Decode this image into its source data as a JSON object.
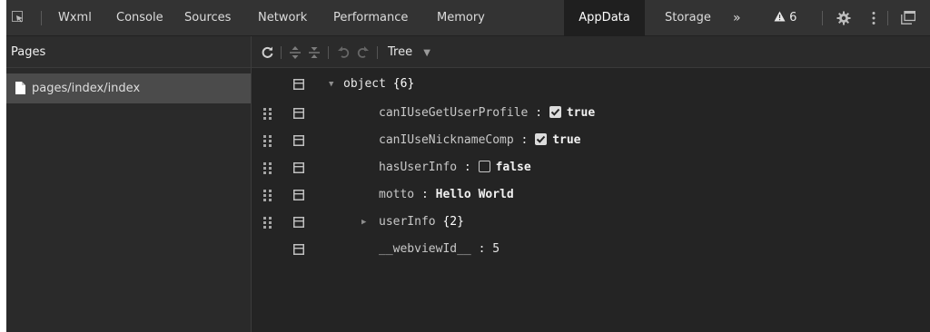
{
  "tabs": [
    {
      "label": "Wxml",
      "active": false
    },
    {
      "label": "Console",
      "active": false
    },
    {
      "label": "Sources",
      "active": false
    },
    {
      "label": "Network",
      "active": false
    },
    {
      "label": "Performance",
      "active": false
    },
    {
      "label": "Memory",
      "active": false
    },
    {
      "label": "AppData",
      "active": true
    },
    {
      "label": "Storage",
      "active": false
    }
  ],
  "more_tabs_label": "»",
  "warning_count": "6",
  "left_panel": {
    "header": "Pages",
    "items": [
      {
        "label": "pages/index/index",
        "selected": true
      }
    ]
  },
  "toolbar": {
    "view_mode": "Tree"
  },
  "tree": {
    "root": {
      "key": "object",
      "count": "{6}"
    },
    "rows": [
      {
        "key": "canIUseGetUserProfile",
        "type": "bool",
        "checked": true,
        "value": "true"
      },
      {
        "key": "canIUseNicknameComp",
        "type": "bool",
        "checked": true,
        "value": "true"
      },
      {
        "key": "hasUserInfo",
        "type": "bool",
        "checked": false,
        "value": "false"
      },
      {
        "key": "motto",
        "type": "string",
        "value": "Hello World"
      },
      {
        "key": "userInfo",
        "type": "object",
        "value": "{2}"
      },
      {
        "key": "__webviewId__",
        "type": "number",
        "value": "5"
      }
    ]
  },
  "colors": {
    "active_tab_bg": "#1f1f1f",
    "tabbar_bg": "#333333",
    "panel_bg": "#242424",
    "selected_page_bg": "#4b4b4b",
    "warning_color": "#e8e8e8"
  },
  "icons": [
    "inspect-icon",
    "warning-icon",
    "gear-icon",
    "more-vert-icon",
    "dock-icon",
    "refresh-icon",
    "expand-all-icon",
    "collapse-all-icon",
    "undo-icon",
    "redo-icon",
    "dropdown-icon",
    "document-icon",
    "drag-handle-icon",
    "collapse-toggle-icon"
  ]
}
